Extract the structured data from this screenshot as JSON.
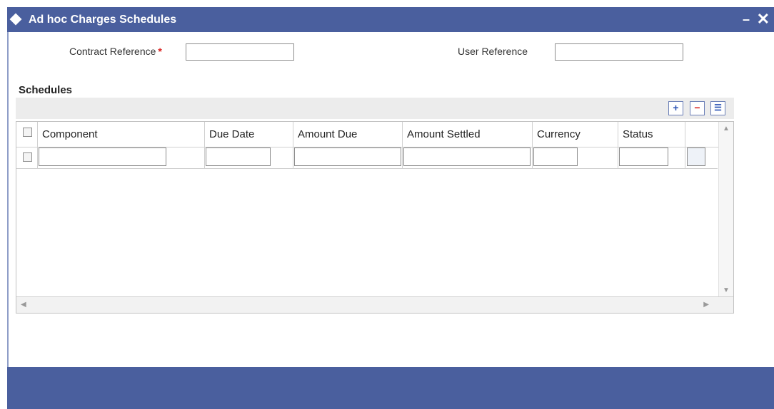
{
  "window": {
    "title": "Ad hoc Charges Schedules",
    "minimize_label": "–",
    "close_label": "✕"
  },
  "form": {
    "contract_reference_label": "Contract Reference",
    "required_marker": "*",
    "contract_reference_value": "",
    "user_reference_label": "User Reference",
    "user_reference_value": ""
  },
  "schedules": {
    "title": "Schedules",
    "toolbar": {
      "add_label": "+",
      "delete_label": "−",
      "view_label": "☰"
    },
    "columns": [
      "Component",
      "Due Date",
      "Amount Due",
      "Amount Settled",
      "Currency",
      "Status"
    ],
    "rows": [
      {
        "component": "",
        "due_date": "",
        "amount_due": "",
        "amount_settled": "",
        "currency": "",
        "status": ""
      }
    ]
  },
  "colors": {
    "titlebar": "#4a5f9e",
    "required": "#d9201e"
  }
}
